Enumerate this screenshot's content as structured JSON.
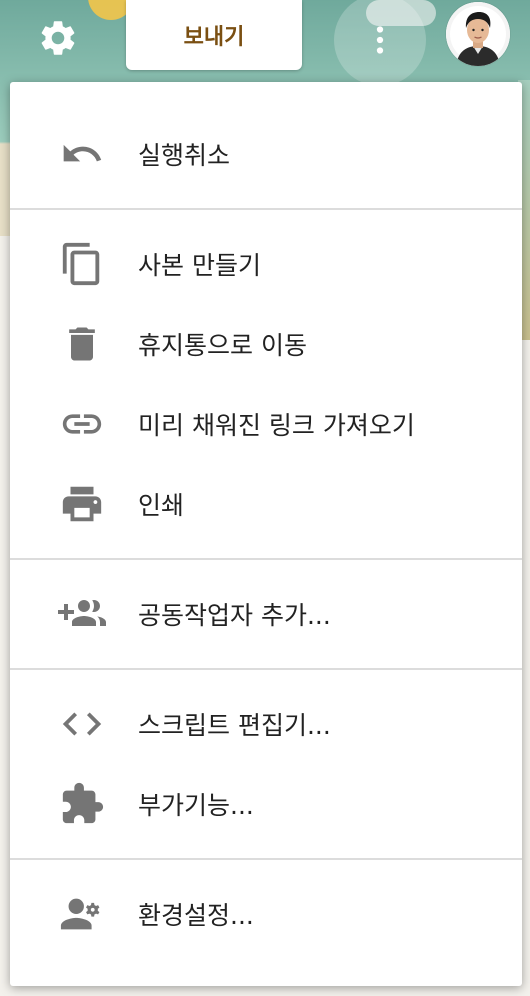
{
  "toolbar": {
    "send_label": "보내기",
    "settings_icon": "gear-icon",
    "more_icon": "more-vert-icon",
    "accent_color": "#7a4f12"
  },
  "menu": {
    "items": [
      {
        "label": "실행취소",
        "icon": "undo-icon"
      },
      {
        "label": "사본 만들기",
        "icon": "copy-icon"
      },
      {
        "label": "휴지통으로 이동",
        "icon": "trash-icon"
      },
      {
        "label": "미리 채워진 링크 가져오기",
        "icon": "link-icon"
      },
      {
        "label": "인쇄",
        "icon": "print-icon"
      },
      {
        "label": "공동작업자 추가...",
        "icon": "add-people-icon"
      },
      {
        "label": "스크립트 편집기...",
        "icon": "code-icon"
      },
      {
        "label": "부가기능...",
        "icon": "puzzle-icon"
      },
      {
        "label": "환경설정...",
        "icon": "person-settings-icon"
      }
    ]
  }
}
